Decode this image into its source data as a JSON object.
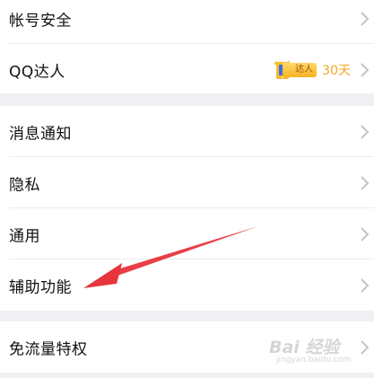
{
  "settings_groups": [
    {
      "items": [
        {
          "label": "帐号安全"
        },
        {
          "label": "QQ达人",
          "badge": {
            "tag": "达人",
            "days": "30天"
          }
        }
      ]
    },
    {
      "items": [
        {
          "label": "消息通知"
        },
        {
          "label": "隐私"
        },
        {
          "label": "通用"
        },
        {
          "label": "辅助功能",
          "highlighted": true
        }
      ]
    },
    {
      "items": [
        {
          "label": "免流量特权"
        }
      ]
    }
  ],
  "watermark": {
    "text": "Bai 经验",
    "sub": "jingyan.baidu.com"
  },
  "colors": {
    "background": "#f0f0f2",
    "row": "#ffffff",
    "text": "#111111",
    "chevron": "#c4c4c4",
    "badge_days": "#f5a623",
    "annotation_arrow": "#e8343c"
  },
  "icons": [
    "chevron-right-icon",
    "qq-talent-badge-icon",
    "annotation-arrow"
  ]
}
